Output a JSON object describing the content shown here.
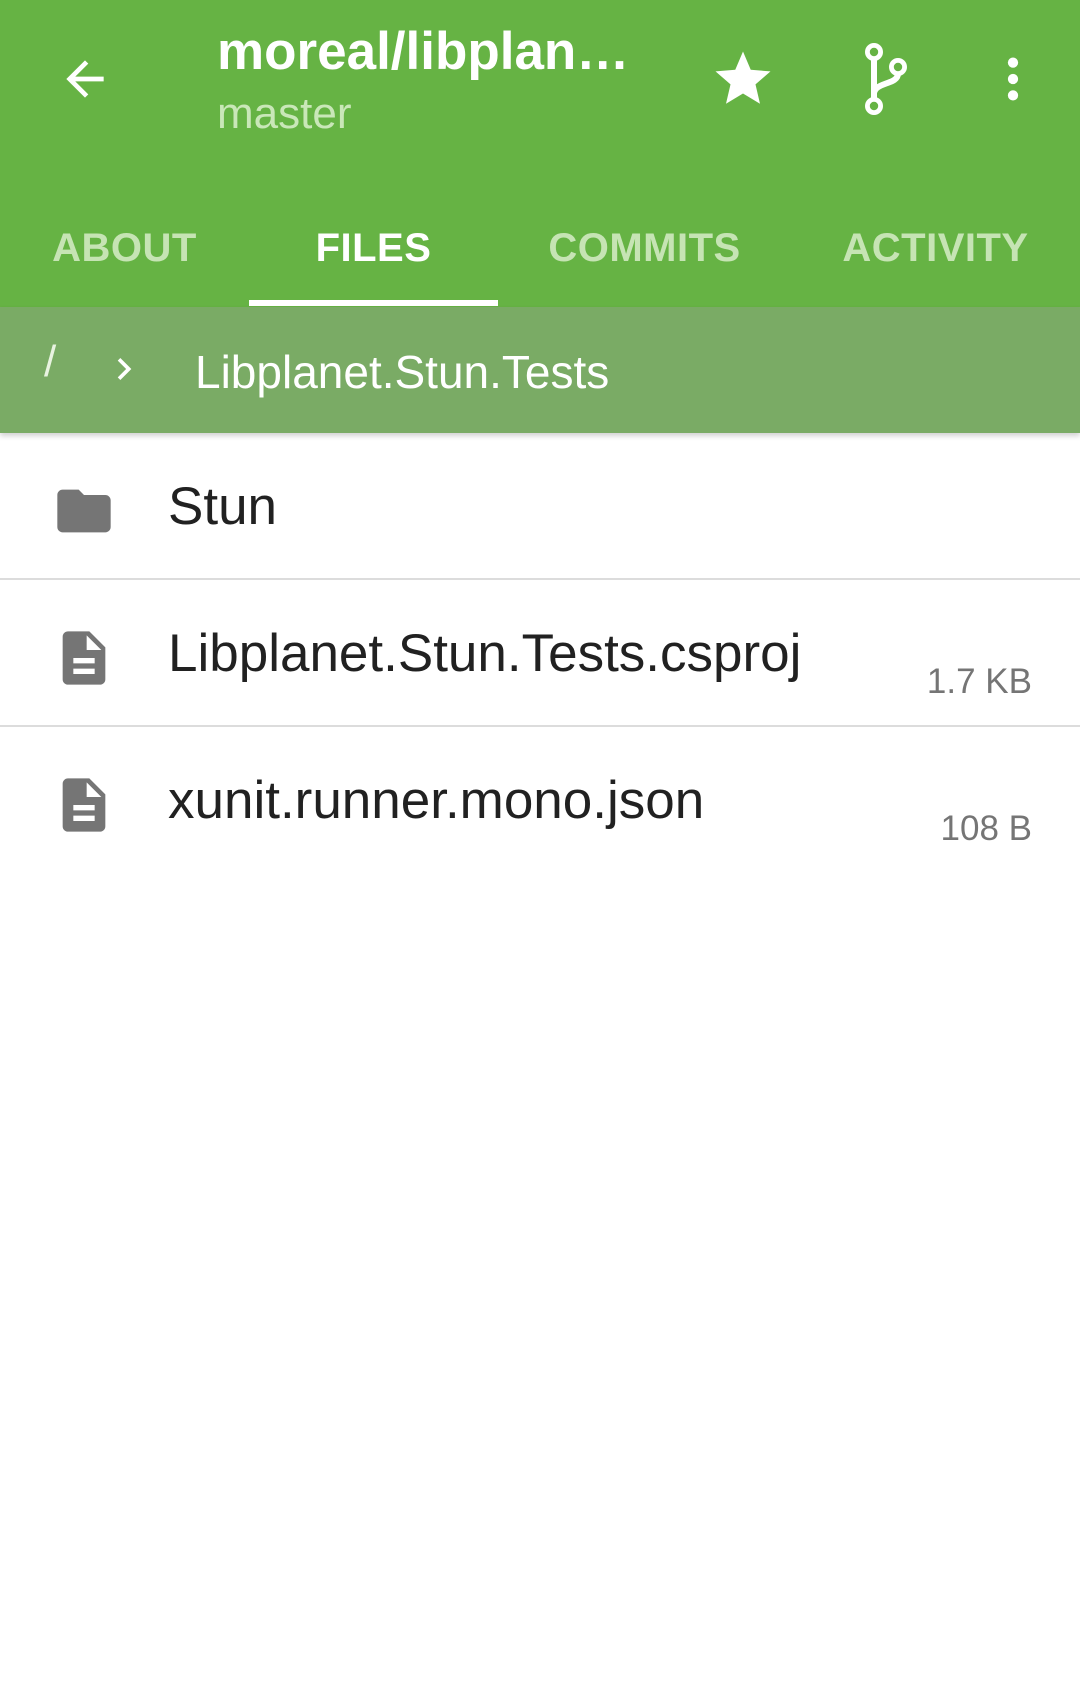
{
  "toolbar": {
    "repo_title": "moreal/libplan…",
    "branch": "master"
  },
  "tabs": [
    {
      "label": "ABOUT"
    },
    {
      "label": "FILES"
    },
    {
      "label": "COMMITS"
    },
    {
      "label": "ACTIVITY"
    }
  ],
  "active_tab": "FILES",
  "breadcrumb": {
    "root": "/",
    "current": "Libplanet.Stun.Tests"
  },
  "files": [
    {
      "name": "Stun",
      "type": "folder",
      "size": ""
    },
    {
      "name": "Libplanet.Stun.Tests.csproj",
      "type": "file",
      "size": "1.7 KB"
    },
    {
      "name": "xunit.runner.mono.json",
      "type": "file",
      "size": "108 B"
    }
  ],
  "colors": {
    "appbar": "#66b344",
    "breadcrumb_bar": "#7aab65",
    "icon_gray": "#757575"
  },
  "icons": {
    "back": "arrow-left-icon",
    "star": "star-icon",
    "branch": "git-branch-icon",
    "more": "more-vert-icon",
    "chevron": "chevron-right-icon",
    "folder": "folder-icon",
    "file": "file-document-icon"
  }
}
